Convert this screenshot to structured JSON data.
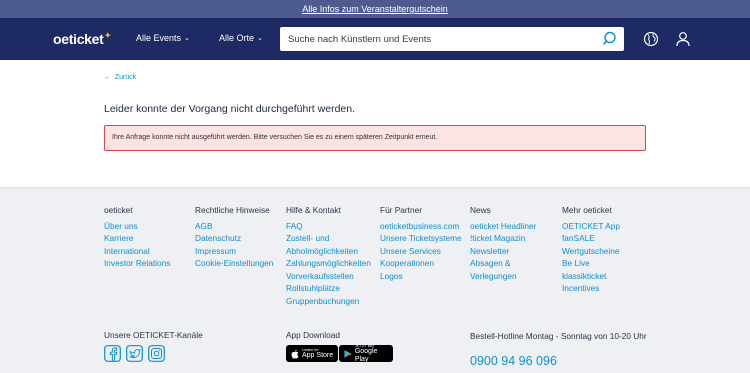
{
  "topbar": {
    "link": "Alle Infos zum Veranstaltergutschein"
  },
  "header": {
    "logo": "oeticket",
    "nav_events": "Alle Events",
    "nav_places": "Alle Orte",
    "search_placeholder": "Suche nach Künstlern und Events"
  },
  "main": {
    "back": "Zurück",
    "headline": "Leider konnte der Vorgang nicht durchgeführt werden.",
    "alert": "Ihre Anfrage konnte nicht ausgeführt werden. Bitte versuchen Sie es zu einem späteren Zeitpunkt erneut."
  },
  "footer": {
    "columns": [
      {
        "heading": "oeticket",
        "links": [
          "Über uns",
          "Karriere",
          "International",
          "Investor Relations"
        ]
      },
      {
        "heading": "Rechtliche Hinweise",
        "links": [
          "AGB",
          "Datenschutz",
          "Impressum",
          "Cookie-Einstellungen"
        ]
      },
      {
        "heading": "Hilfe & Kontakt",
        "links": [
          "FAQ",
          "Zustell- und",
          "Abholmöglichkeiten",
          "Zahlungsmöglichkeiten",
          "Vorverkaufsstellen",
          "Rollstuhlplätze",
          "Gruppenbuchungen"
        ]
      },
      {
        "heading": "Für Partner",
        "links": [
          "oeticketbusiness.com",
          "Unsere Ticketsysteme",
          "Unsere Services",
          "Kooperationen",
          "Logos"
        ]
      },
      {
        "heading": "News",
        "links": [
          "oeticket Headliner",
          "!ticket Magazin",
          "Newsletter",
          "Absagen &",
          "Verlegungen"
        ]
      },
      {
        "heading": "Mehr oeticket",
        "links": [
          "OETICKET App",
          "fanSALE",
          "Wertgutscheine",
          "Be Live",
          "klassikticket",
          "Incentives"
        ]
      }
    ],
    "channels_label": "Unsere OETICKET-Kanäle",
    "app_label": "App Download",
    "appstore_small": "Laden im",
    "appstore_big": "App Store",
    "googleplay_small": "JETZT BEI",
    "googleplay_big": "Google Play",
    "hotline_label": "Bestell-Hotline Montag - Sonntag von 10-20 Uhr",
    "phone": "0900 94 96 096"
  }
}
